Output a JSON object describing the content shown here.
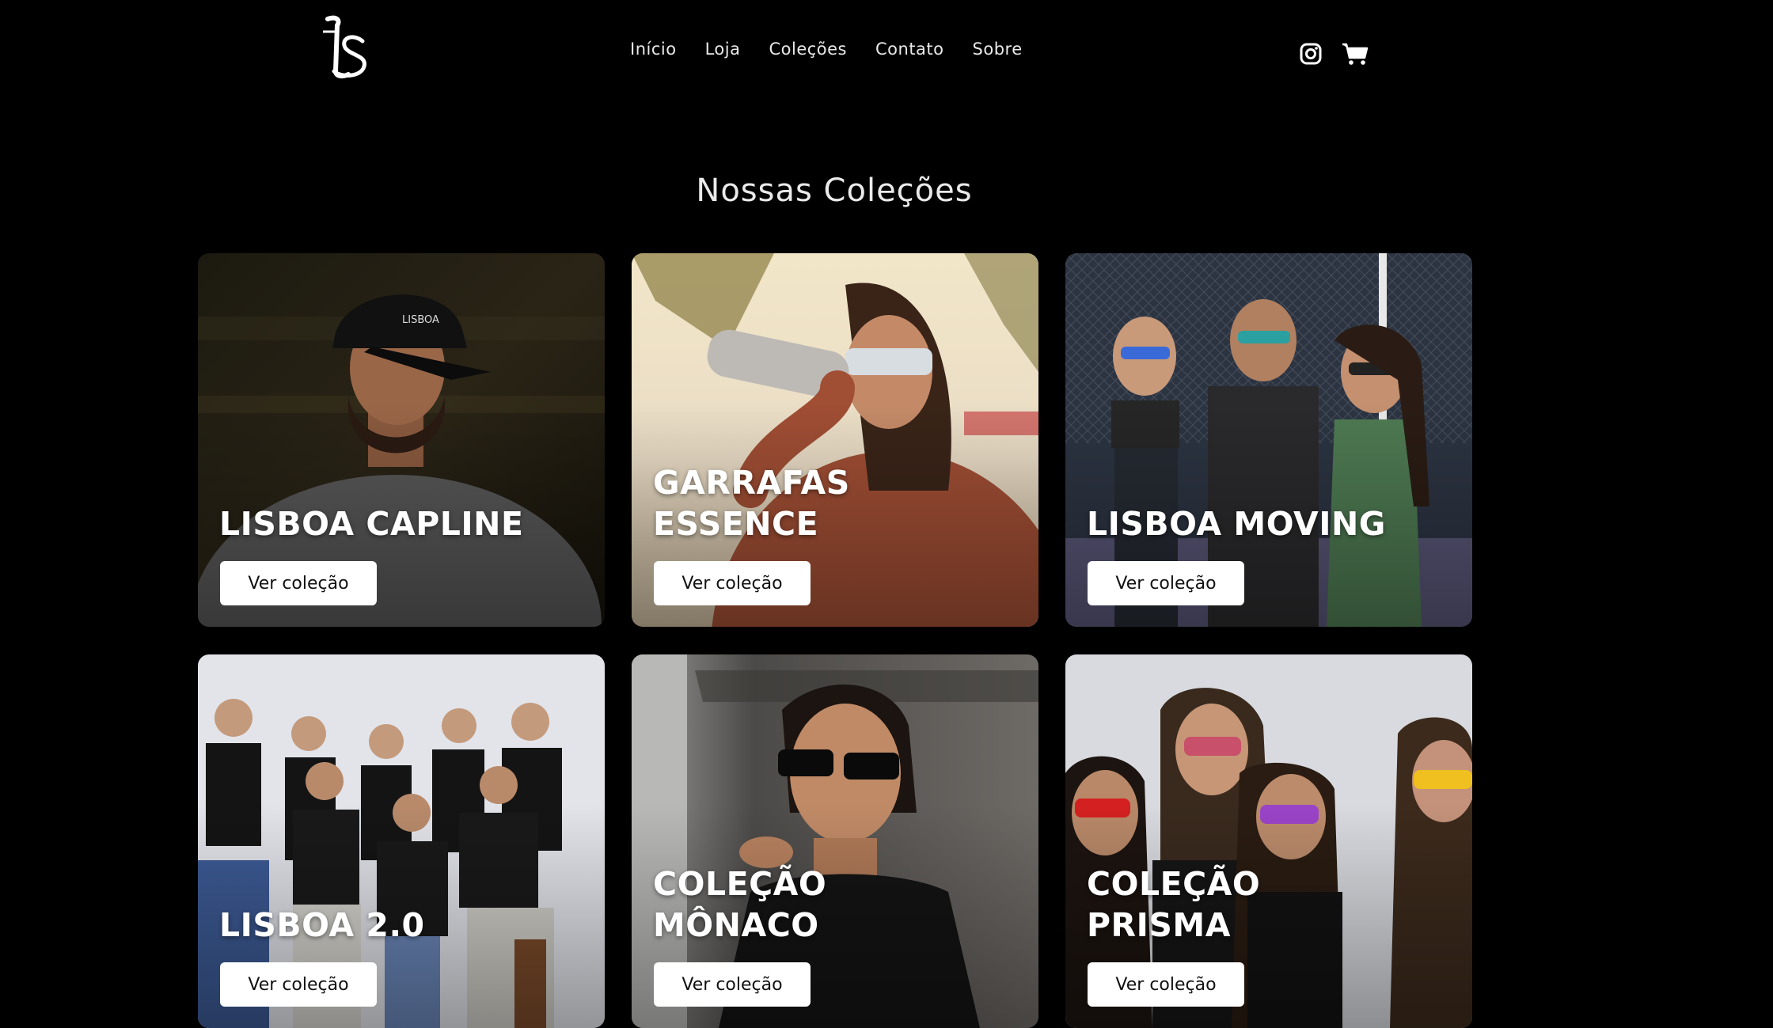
{
  "header": {
    "nav": [
      {
        "label": "Início"
      },
      {
        "label": "Loja"
      },
      {
        "label": "Coleções"
      },
      {
        "label": "Contato"
      },
      {
        "label": "Sobre"
      }
    ],
    "icons": [
      "instagram-icon",
      "cart-icon"
    ]
  },
  "main": {
    "title": "Nossas Coleções",
    "collections": [
      {
        "title": "LISBOA CAPLINE",
        "button": "Ver coleção"
      },
      {
        "title": "GARRAFAS\nESSENCE",
        "button": "Ver coleção"
      },
      {
        "title": "LISBOA MOVING",
        "button": "Ver coleção"
      },
      {
        "title": "LISBOA 2.0",
        "button": "Ver coleção"
      },
      {
        "title": "COLEÇÃO\nMÔNACO",
        "button": "Ver coleção"
      },
      {
        "title": "COLEÇÃO\nPRISMA",
        "button": "Ver coleção"
      }
    ]
  },
  "colors": {
    "background": "#000000",
    "nav_text": "#e9e9e9",
    "button_bg": "#ffffff",
    "button_text": "#111111"
  }
}
